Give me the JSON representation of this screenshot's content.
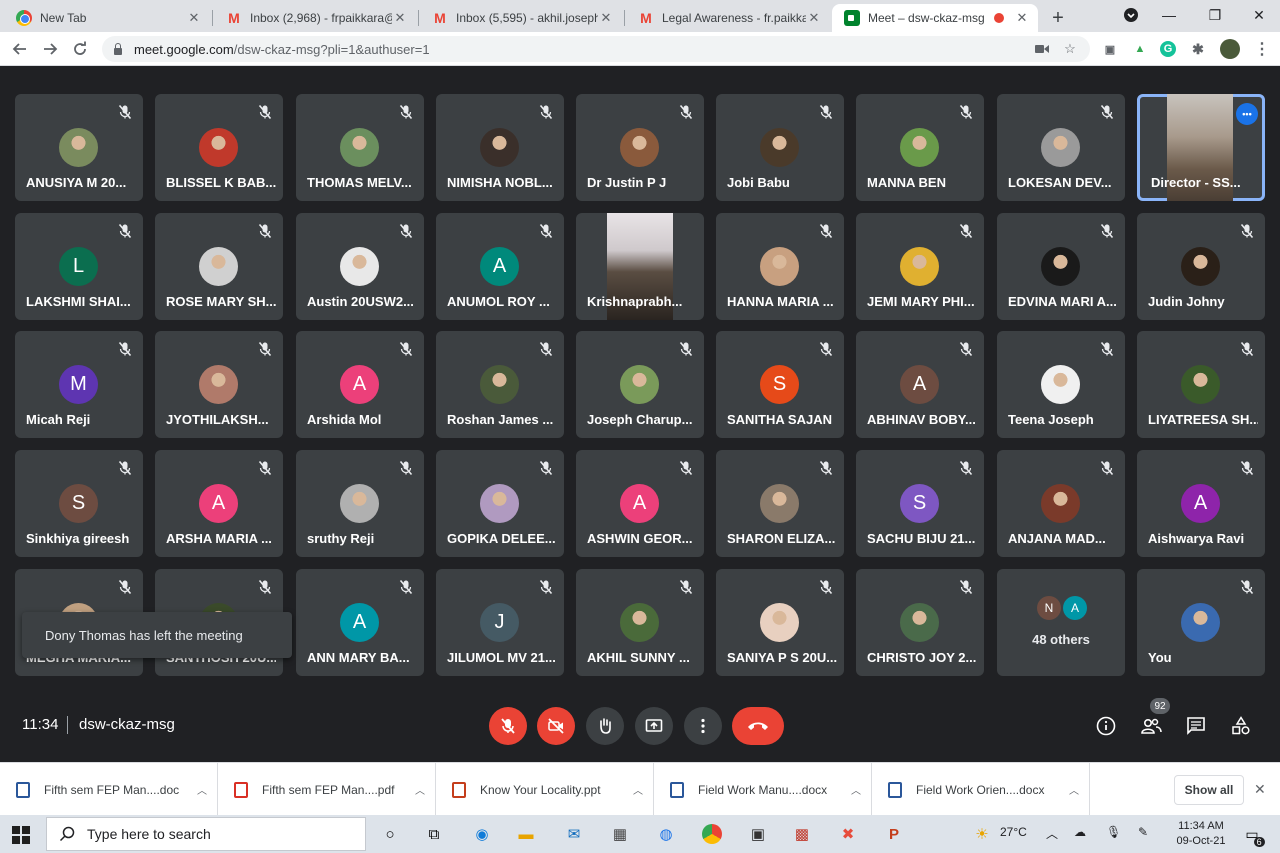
{
  "browser": {
    "tabs": [
      {
        "title": "New Tab",
        "favicon": "chrome-icon",
        "active": false
      },
      {
        "title": "Inbox (2,968) - frpaikkara@g",
        "favicon": "gmail-icon",
        "active": false
      },
      {
        "title": "Inbox (5,595) - akhil.joseph@",
        "favicon": "gmail-icon",
        "active": false
      },
      {
        "title": "Legal Awareness - fr.paikkara",
        "favicon": "gmail-icon",
        "active": false
      },
      {
        "title": "Meet – dsw-ckaz-msg",
        "favicon": "meet-icon",
        "active": true,
        "recording": true
      }
    ],
    "url_host": "meet.google.com",
    "url_path": "/dsw-ckaz-msg?pli=1&authuser=1"
  },
  "participants": [
    {
      "name": "ANUSIYA M 20...",
      "avatar": "photo",
      "color": "#7a8b5e"
    },
    {
      "name": "BLISSEL K BAB...",
      "avatar": "photo",
      "color": "#c0392b"
    },
    {
      "name": "THOMAS MELV...",
      "avatar": "photo",
      "color": "#6b8f5e"
    },
    {
      "name": "NIMISHA NOBL...",
      "avatar": "photo",
      "color": "#3a2f2a"
    },
    {
      "name": "Dr Justin P J",
      "avatar": "photo",
      "color": "#8a5a3c"
    },
    {
      "name": "Jobi Babu",
      "avatar": "photo",
      "color": "#4a3a2a"
    },
    {
      "name": "MANNA BEN",
      "avatar": "photo",
      "color": "#6a9a4a"
    },
    {
      "name": "LOKESAN DEV...",
      "avatar": "photo",
      "color": "#9a9a9a"
    },
    {
      "name": "Director - SS...",
      "avatar": "video",
      "self_view": true
    },
    {
      "name": "LAKSHMI SHAI...",
      "avatar": "L",
      "color": "#0b6e4f"
    },
    {
      "name": "ROSE MARY SH...",
      "avatar": "photo",
      "color": "#d0d0d0"
    },
    {
      "name": "Austin 20USW2...",
      "avatar": "photo",
      "color": "#e8e8e8"
    },
    {
      "name": "ANUMOL ROY ...",
      "avatar": "A",
      "color": "#00897b"
    },
    {
      "name": "Krishnaprabh...",
      "avatar": "video"
    },
    {
      "name": "HANNA MARIA ...",
      "avatar": "photo",
      "color": "#c8a080"
    },
    {
      "name": "JEMI MARY PHI...",
      "avatar": "photo",
      "color": "#e0b030"
    },
    {
      "name": "EDVINA MARI A...",
      "avatar": "photo",
      "color": "#1a1a1a"
    },
    {
      "name": "Judin Johny",
      "avatar": "photo",
      "color": "#2a2018"
    },
    {
      "name": "Micah Reji",
      "avatar": "M",
      "color": "#5e35b1"
    },
    {
      "name": "JYOTHILAKSH...",
      "avatar": "photo",
      "color": "#b07a6a"
    },
    {
      "name": "Arshida Mol",
      "avatar": "A",
      "color": "#ec407a"
    },
    {
      "name": "Roshan James ...",
      "avatar": "photo",
      "color": "#4a5a3a"
    },
    {
      "name": "Joseph Charup...",
      "avatar": "photo",
      "color": "#7a9a5a"
    },
    {
      "name": "SANITHA SAJAN",
      "avatar": "S",
      "color": "#e64a19"
    },
    {
      "name": "ABHINAV BOBY...",
      "avatar": "A",
      "color": "#6d4c41"
    },
    {
      "name": "Teena Joseph",
      "avatar": "photo",
      "color": "#f0f0f0"
    },
    {
      "name": "LIYATREESA SH...",
      "avatar": "photo",
      "color": "#3a5a2a"
    },
    {
      "name": "Sinkhiya gireesh",
      "avatar": "S",
      "color": "#6d4c41"
    },
    {
      "name": "ARSHA MARIA ...",
      "avatar": "A",
      "color": "#ec407a"
    },
    {
      "name": "sruthy Reji",
      "avatar": "photo",
      "color": "#b0b0b0"
    },
    {
      "name": "GOPIKA DELEE...",
      "avatar": "photo",
      "color": "#b09ac0"
    },
    {
      "name": "ASHWIN GEOR...",
      "avatar": "A",
      "color": "#ec407a"
    },
    {
      "name": "SHARON ELIZA...",
      "avatar": "photo",
      "color": "#8a7a6a"
    },
    {
      "name": "SACHU BIJU 21...",
      "avatar": "S",
      "color": "#7e57c2"
    },
    {
      "name": "ANJANA MAD...",
      "avatar": "photo",
      "color": "#7a3a2a"
    },
    {
      "name": "Aishwarya Ravi",
      "avatar": "A",
      "color": "#8e24aa"
    },
    {
      "name": "MEGHA MARIA...",
      "avatar": "photo",
      "color": "#c0a080"
    },
    {
      "name": "SANTHOSH 20U...",
      "avatar": "photo",
      "color": "#3a4a2a"
    },
    {
      "name": "ANN MARY BA...",
      "avatar": "A",
      "color": "#0097a7"
    },
    {
      "name": "JILUMOL MV 21...",
      "avatar": "J",
      "color": "#455a64"
    },
    {
      "name": "AKHIL SUNNY ...",
      "avatar": "photo",
      "color": "#4a6a3a"
    },
    {
      "name": "SANIYA P S 20U...",
      "avatar": "photo",
      "color": "#e8d0c0"
    },
    {
      "name": "CHRISTO JOY 2...",
      "avatar": "photo",
      "color": "#4a6a4a"
    },
    {
      "name": "48 others",
      "avatar": "others",
      "initials": [
        "N",
        "A"
      ],
      "colors": [
        "#6d4c41",
        "#0097a7"
      ]
    },
    {
      "name": "You",
      "avatar": "photo",
      "color": "#3a6ab0"
    }
  ],
  "toast": "Dony Thomas has left the meeting",
  "meeting": {
    "time": "11:34",
    "code": "dsw-ckaz-msg",
    "participant_count": "92"
  },
  "downloads": [
    {
      "name": "Fifth sem FEP Man....doc",
      "type": "word"
    },
    {
      "name": "Fifth sem FEP Man....pdf",
      "type": "pdf"
    },
    {
      "name": "Know Your Locality.ppt",
      "type": "ppt"
    },
    {
      "name": "Field Work Manu....docx",
      "type": "word"
    },
    {
      "name": "Field Work Orien....docx",
      "type": "word"
    }
  ],
  "downloads_show_all": "Show all",
  "taskbar": {
    "search_placeholder": "Type here to search",
    "temperature": "27°C",
    "clock_time": "11:34 AM",
    "clock_date": "09-Oct-21",
    "notification_count": "6"
  }
}
